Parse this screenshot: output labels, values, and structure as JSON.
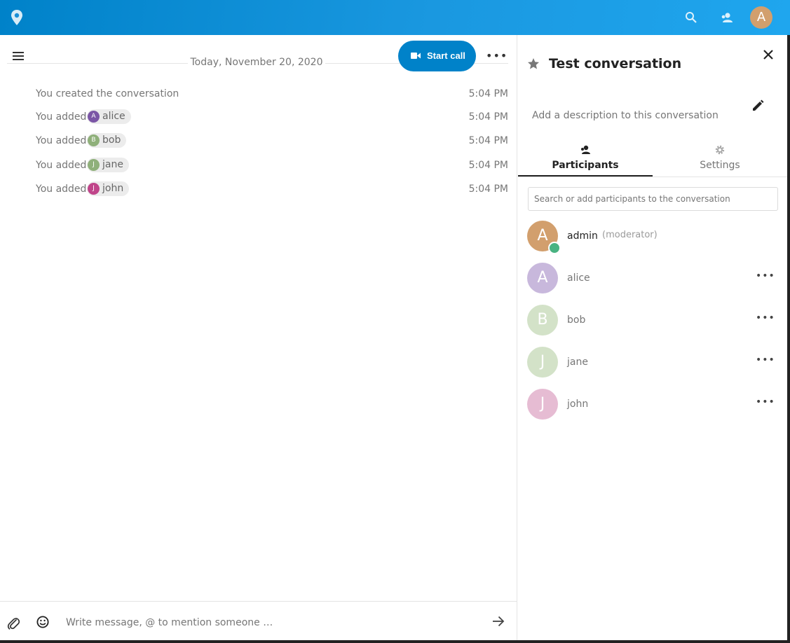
{
  "colors": {
    "header_gradient_start": "#0082c9",
    "header_gradient_end": "#1fa6ee",
    "primary": "#0082c9",
    "online_status": "#49b382"
  },
  "header": {
    "logo_icon": "location-pin-icon",
    "search_icon": "search-icon",
    "contacts_icon": "contacts-icon",
    "user_avatar_initial": "A"
  },
  "chat": {
    "date_label": "Today, November 20, 2020",
    "start_call_label": "Start call",
    "more_label": "•••",
    "messages": [
      {
        "text": "You created the conversation",
        "time": "5:04 PM"
      },
      {
        "text": "You added",
        "mention": "alice",
        "mention_initial": "A",
        "mention_color": "#7b56a6",
        "time": "5:04 PM"
      },
      {
        "text": "You added",
        "mention": "bob",
        "mention_initial": "B",
        "mention_color": "#8fb07a",
        "time": "5:04 PM"
      },
      {
        "text": "You added",
        "mention": "jane",
        "mention_initial": "J",
        "mention_color": "#8fb07a",
        "time": "5:04 PM"
      },
      {
        "text": "You added",
        "mention": "john",
        "mention_initial": "J",
        "mention_color": "#c0458a",
        "time": "5:04 PM"
      }
    ],
    "composer": {
      "placeholder": "Write message, @ to mention someone …"
    }
  },
  "sidebar": {
    "title": "Test conversation",
    "description_placeholder": "Add a description to this conversation",
    "tabs": [
      {
        "label": "Participants",
        "icon": "participants-icon"
      },
      {
        "label": "Settings",
        "icon": "gear-icon"
      }
    ],
    "search_placeholder": "Search or add participants to the conversation",
    "participants": [
      {
        "initial": "A",
        "name": "admin",
        "role": "(moderator)",
        "color": "#d29f6d",
        "name_color": "#222222",
        "online": true
      },
      {
        "initial": "A",
        "name": "alice",
        "role": "",
        "color": "#c8b8dc",
        "name_color": "#767676",
        "online": false
      },
      {
        "initial": "B",
        "name": "bob",
        "role": "",
        "color": "#d3e2c8",
        "name_color": "#767676",
        "online": false
      },
      {
        "initial": "J",
        "name": "jane",
        "role": "",
        "color": "#d3e2c8",
        "name_color": "#767676",
        "online": false
      },
      {
        "initial": "J",
        "name": "john",
        "role": "",
        "color": "#e6bcd3",
        "name_color": "#767676",
        "online": false
      }
    ],
    "participant_more_label": "•••"
  }
}
